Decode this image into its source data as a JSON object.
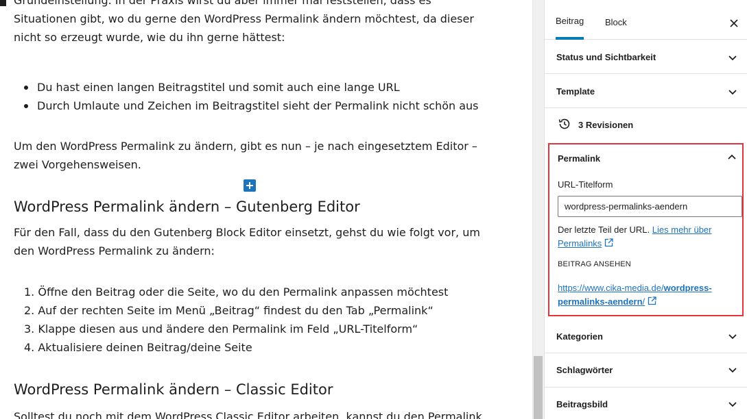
{
  "article": {
    "intro_paragraph": "Grundeinstellung. In der Praxis wirst du aber immer mal feststellen, dass es Situationen gibt, wo du gerne den WordPress Permalink ändern möchtest, da dieser nicht so erzeugt wurde, wie du ihn gerne hättest:",
    "bullets": [
      "Du hast einen langen Beitragstitel und somit auch eine lange URL",
      "Durch Umlaute und Zeichen im Beitragstitel sieht der Permalink nicht schön aus"
    ],
    "paragraph_2": "Um den WordPress Permalink zu ändern, gibt es nun – je nach eingesetztem Editor – zwei Vorgehensweisen.",
    "heading_gutenberg": "WordPress Permalink ändern – Gutenberg Editor",
    "paragraph_3": "Für den Fall, dass du den Gutenberg Block Editor einsetzt, gehst du wie folgt vor, um den WordPress Permalink zu ändern:",
    "steps": [
      "1. Öffne den Beitrag oder die Seite, wo du den Permalink anpassen möchtest",
      "2. Auf der rechten Seite im Menü „Beitrag“ findest du den Tab „Permalink“",
      "3. Klappe diesen aus und ändere den Permalink im Feld „URL-Titelform“",
      "4. Aktualisiere deinen Beitrag/deine Seite"
    ],
    "heading_classic": "WordPress Permalink ändern – Classic Editor",
    "paragraph_4": "Solltest du noch mit dem WordPress Classic Editor arbeiten, kannst du den Permalink"
  },
  "sidebar": {
    "tabs": [
      "Beitrag",
      "Block"
    ],
    "panels": {
      "status": "Status und Sichtbarkeit",
      "template": "Template",
      "revisions": "3 Revisionen",
      "categories": "Kategorien",
      "tags": "Schlagwörter",
      "featured_image": "Beitragsbild"
    },
    "permalink": {
      "title": "Permalink",
      "url_label": "URL-Titelform",
      "slug_value": "wordpress-permalinks-aendern",
      "help_text": "Der letzte Teil der URL.",
      "help_link_line1": "Lies mehr über",
      "help_link_line2": "Permalinks",
      "view_heading": "BEITRAG ANSEHEN",
      "view_url_base": "https://www.cika-media.de/",
      "view_url_slug_part1": "wordpress-",
      "view_url_slug_part2": "permalinks-aendern",
      "view_url_tail": "/"
    }
  },
  "colors": {
    "accent": "#007cba",
    "link": "#1e73be",
    "highlight_border": "#e0343f"
  }
}
